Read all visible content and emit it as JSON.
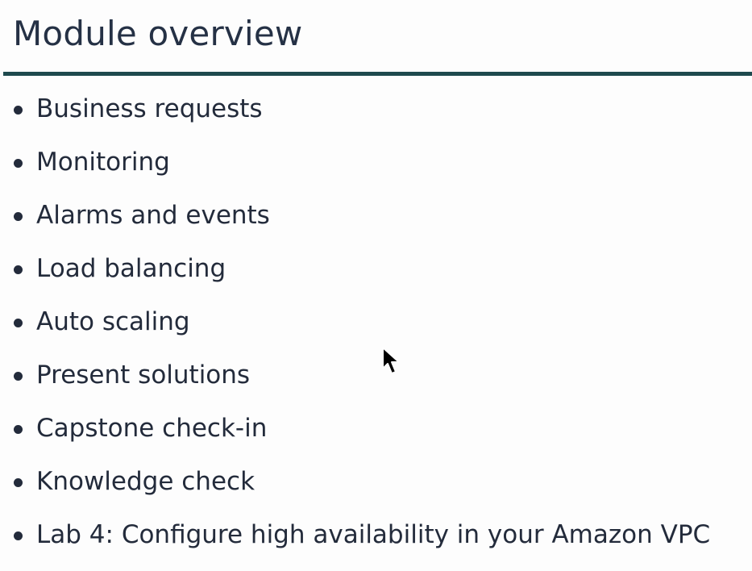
{
  "slide": {
    "title": "Module overview",
    "bullets": [
      "Business requests",
      "Monitoring",
      "Alarms and events",
      "Load balancing",
      "Auto scaling",
      "Present solutions",
      "Capstone check-in",
      "Knowledge check",
      "Lab 4: Configure high availability in your Amazon VPC"
    ]
  },
  "colors": {
    "title": "#253145",
    "rule": "#1e4a4e",
    "text": "#232b3b"
  },
  "icons": {
    "cursor": "mouse-pointer-icon"
  }
}
